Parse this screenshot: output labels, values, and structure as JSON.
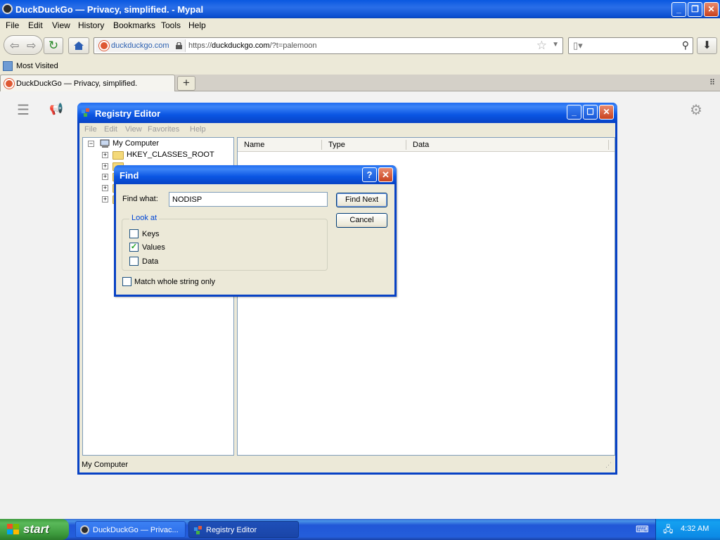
{
  "browser": {
    "title": "DuckDuckGo — Privacy, simplified. - Mypal",
    "menu": [
      "File",
      "Edit",
      "View",
      "History",
      "Bookmarks",
      "Tools",
      "Help"
    ],
    "identity": "duckduckgo.com",
    "url_prefix": "https://",
    "url_domain": "duckduckgo.com",
    "url_path": "/?t=palemoon",
    "bookmark": "Most Visited",
    "tab_title": "DuckDuckGo — Privacy, simplified.",
    "new_tab": "+"
  },
  "registry": {
    "title": "Registry Editor",
    "menu": [
      "File",
      "Edit",
      "View",
      "Favorites",
      "Help"
    ],
    "tree": {
      "root": "My Computer",
      "items": [
        "HKEY_CLASSES_ROOT"
      ]
    },
    "columns": [
      "Name",
      "Type",
      "Data"
    ],
    "status": "My Computer"
  },
  "find_dialog": {
    "title": "Find",
    "find_what_label": "Find what:",
    "find_what_value": "NODISP",
    "find_next": "Find Next",
    "cancel": "Cancel",
    "look_at": "Look at",
    "keys": "Keys",
    "values": "Values",
    "data": "Data",
    "match_whole": "Match whole string only",
    "checked": {
      "keys": false,
      "values": true,
      "data": false,
      "match_whole": false
    }
  },
  "taskbar": {
    "start": "start",
    "tasks": [
      "DuckDuckGo — Privac...",
      "Registry Editor"
    ],
    "clock": "4:32 AM"
  }
}
